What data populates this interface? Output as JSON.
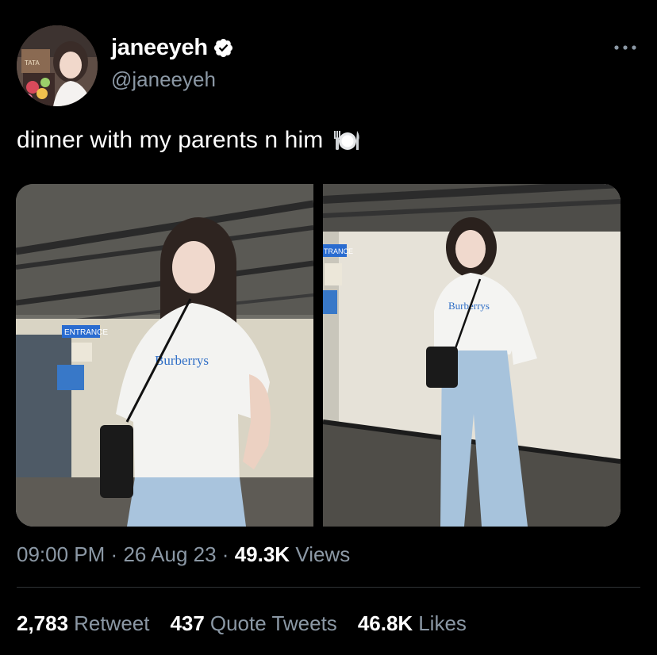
{
  "user": {
    "display_name": "janeeyeh",
    "handle": "@janeeyeh",
    "verified": true,
    "avatar_sign_text": "TATA"
  },
  "tweet": {
    "text": "dinner with my parents n him",
    "emoji": "fork-knife-plate-emoji"
  },
  "photos": [
    {
      "sign_text": "ENTRANCE",
      "shirt_text": "Burberrys"
    },
    {
      "sign_text": "TRANCE",
      "shirt_text": "Burberrys"
    }
  ],
  "meta": {
    "time": "09:00 PM",
    "sep1": "·",
    "date": "26 Aug 23",
    "sep2": "·",
    "views_count": "49.3K",
    "views_label": "Views"
  },
  "stats": {
    "retweets_count": "2,783",
    "retweets_label": "Retweet",
    "quotes_count": "437",
    "quotes_label": "Quote Tweets",
    "likes_count": "46.8K",
    "likes_label": "Likes"
  },
  "colors": {
    "background": "#000000",
    "text_primary": "#ffffff",
    "text_secondary": "#8b98a5",
    "verified": "#ffffff",
    "divider": "#2f3336"
  },
  "icons": {
    "verified": "verified-badge-icon",
    "more": "more-dots-icon"
  }
}
